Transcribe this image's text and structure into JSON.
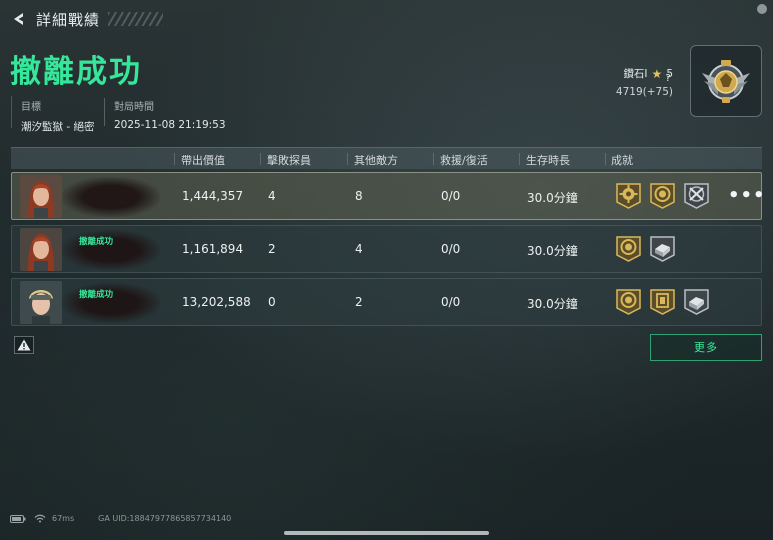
{
  "header": {
    "title": "詳細戰績"
  },
  "result": {
    "title": "撤離成功"
  },
  "match": {
    "goal_label": "目標",
    "goal_value": "潮汐監獄 - 絕密",
    "time_label": "對局時間",
    "time_value": "2025-11-08 21:19:53"
  },
  "rank": {
    "name": "鑽石I",
    "stars": "5",
    "points": "4719(+75)",
    "help": "?"
  },
  "table": {
    "headers": {
      "value": "帶出價值",
      "kills": "擊敗探員",
      "other": "其他敵方",
      "rescue": "救援/復活",
      "survive": "生存時長",
      "achievements": "成就"
    },
    "rows": [
      {
        "status": "",
        "value": "1,444,357",
        "kills": "4",
        "other": "8",
        "rescue": "0/0",
        "survive": "30.0分鐘",
        "badges": [
          "gold-gear-badge",
          "gold-medal-badge",
          "silver-swords-badge"
        ]
      },
      {
        "status": "撤離成功",
        "value": "1,161,894",
        "kills": "2",
        "other": "4",
        "rescue": "0/0",
        "survive": "30.0分鐘",
        "badges": [
          "gold-medal-badge",
          "silver-crate-badge"
        ]
      },
      {
        "status": "撤離成功",
        "value": "13,202,588",
        "kills": "0",
        "other": "2",
        "rescue": "0/0",
        "survive": "30.0分鐘",
        "badges": [
          "gold-medal-badge",
          "gold-card-badge",
          "silver-crate-badge"
        ]
      }
    ],
    "more_menu": "•••"
  },
  "actions": {
    "more_button": "更多"
  },
  "statusbar": {
    "ping": "67ms",
    "uid": "GA UID:18847977865857734140"
  },
  "colors": {
    "accent_green": "#35e79a",
    "gold": "#d9b85a",
    "silver": "#b9c0c4"
  }
}
